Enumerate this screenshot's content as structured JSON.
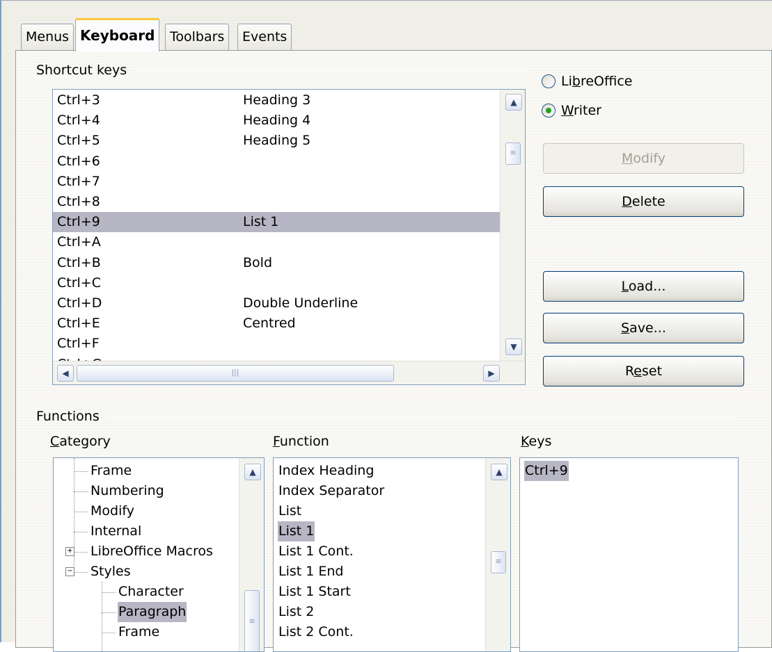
{
  "tabs": [
    {
      "label": "Menus"
    },
    {
      "label": "Keyboard"
    },
    {
      "label": "Toolbars"
    },
    {
      "label": "Events"
    }
  ],
  "shortcut_keys": {
    "title": "Shortcut keys",
    "rows": [
      {
        "key": "Ctrl+3",
        "func": "Heading 3"
      },
      {
        "key": "Ctrl+4",
        "func": "Heading 4"
      },
      {
        "key": "Ctrl+5",
        "func": "Heading 5"
      },
      {
        "key": "Ctrl+6",
        "func": ""
      },
      {
        "key": "Ctrl+7",
        "func": ""
      },
      {
        "key": "Ctrl+8",
        "func": ""
      },
      {
        "key": "Ctrl+9",
        "func": "List 1",
        "selected": true
      },
      {
        "key": "Ctrl+A",
        "func": ""
      },
      {
        "key": "Ctrl+B",
        "func": "Bold"
      },
      {
        "key": "Ctrl+C",
        "func": ""
      },
      {
        "key": "Ctrl+D",
        "func": "Double Underline"
      },
      {
        "key": "Ctrl+E",
        "func": "Centred"
      },
      {
        "key": "Ctrl+F",
        "func": ""
      },
      {
        "key": "Ctrl+G",
        "func": ""
      }
    ]
  },
  "scope": {
    "libreoffice": {
      "pre": "Li",
      "accel": "b",
      "post": "reOffice",
      "checked": false
    },
    "writer": {
      "pre": "",
      "accel": "W",
      "post": "riter",
      "checked": true
    }
  },
  "buttons": {
    "modify": {
      "pre": "",
      "accel": "M",
      "post": "odify",
      "enabled": false
    },
    "delete": {
      "pre": "",
      "accel": "D",
      "post": "elete"
    },
    "load": {
      "pre": "",
      "accel": "L",
      "post": "oad..."
    },
    "save": {
      "pre": "",
      "accel": "S",
      "post": "ave..."
    },
    "reset": {
      "pre": "R",
      "accel": "e",
      "post": "set"
    }
  },
  "functions": {
    "title": "Functions",
    "category": {
      "label_accel": "C",
      "label_rest": "ategory",
      "items": [
        {
          "label": "Frame",
          "level": 1
        },
        {
          "label": "Numbering",
          "level": 1
        },
        {
          "label": "Modify",
          "level": 1
        },
        {
          "label": "Internal",
          "level": 1
        },
        {
          "label": "LibreOffice Macros",
          "level": 0,
          "expander": "+"
        },
        {
          "label": "Styles",
          "level": 0,
          "expander": "−"
        },
        {
          "label": "Character",
          "level": 2
        },
        {
          "label": "Paragraph",
          "level": 2,
          "selected": true
        },
        {
          "label": "Frame",
          "level": 2
        }
      ]
    },
    "function": {
      "label_accel": "F",
      "label_rest": "unction",
      "items": [
        {
          "label": "Index Heading"
        },
        {
          "label": "Index Separator"
        },
        {
          "label": "List"
        },
        {
          "label": "List 1",
          "selected": true
        },
        {
          "label": "List 1 Cont."
        },
        {
          "label": "List 1 End"
        },
        {
          "label": "List 1 Start"
        },
        {
          "label": "List 2"
        },
        {
          "label": "List 2 Cont."
        }
      ]
    },
    "keys": {
      "label_accel": "K",
      "label_rest": "eys",
      "items": [
        {
          "label": "Ctrl+9",
          "selected": true
        }
      ]
    }
  },
  "colors": {
    "selection": "#b7b6c4",
    "active_tab_accent": "#ffc83c",
    "radio_dot": "#21a121",
    "button_border": "#003c74"
  }
}
